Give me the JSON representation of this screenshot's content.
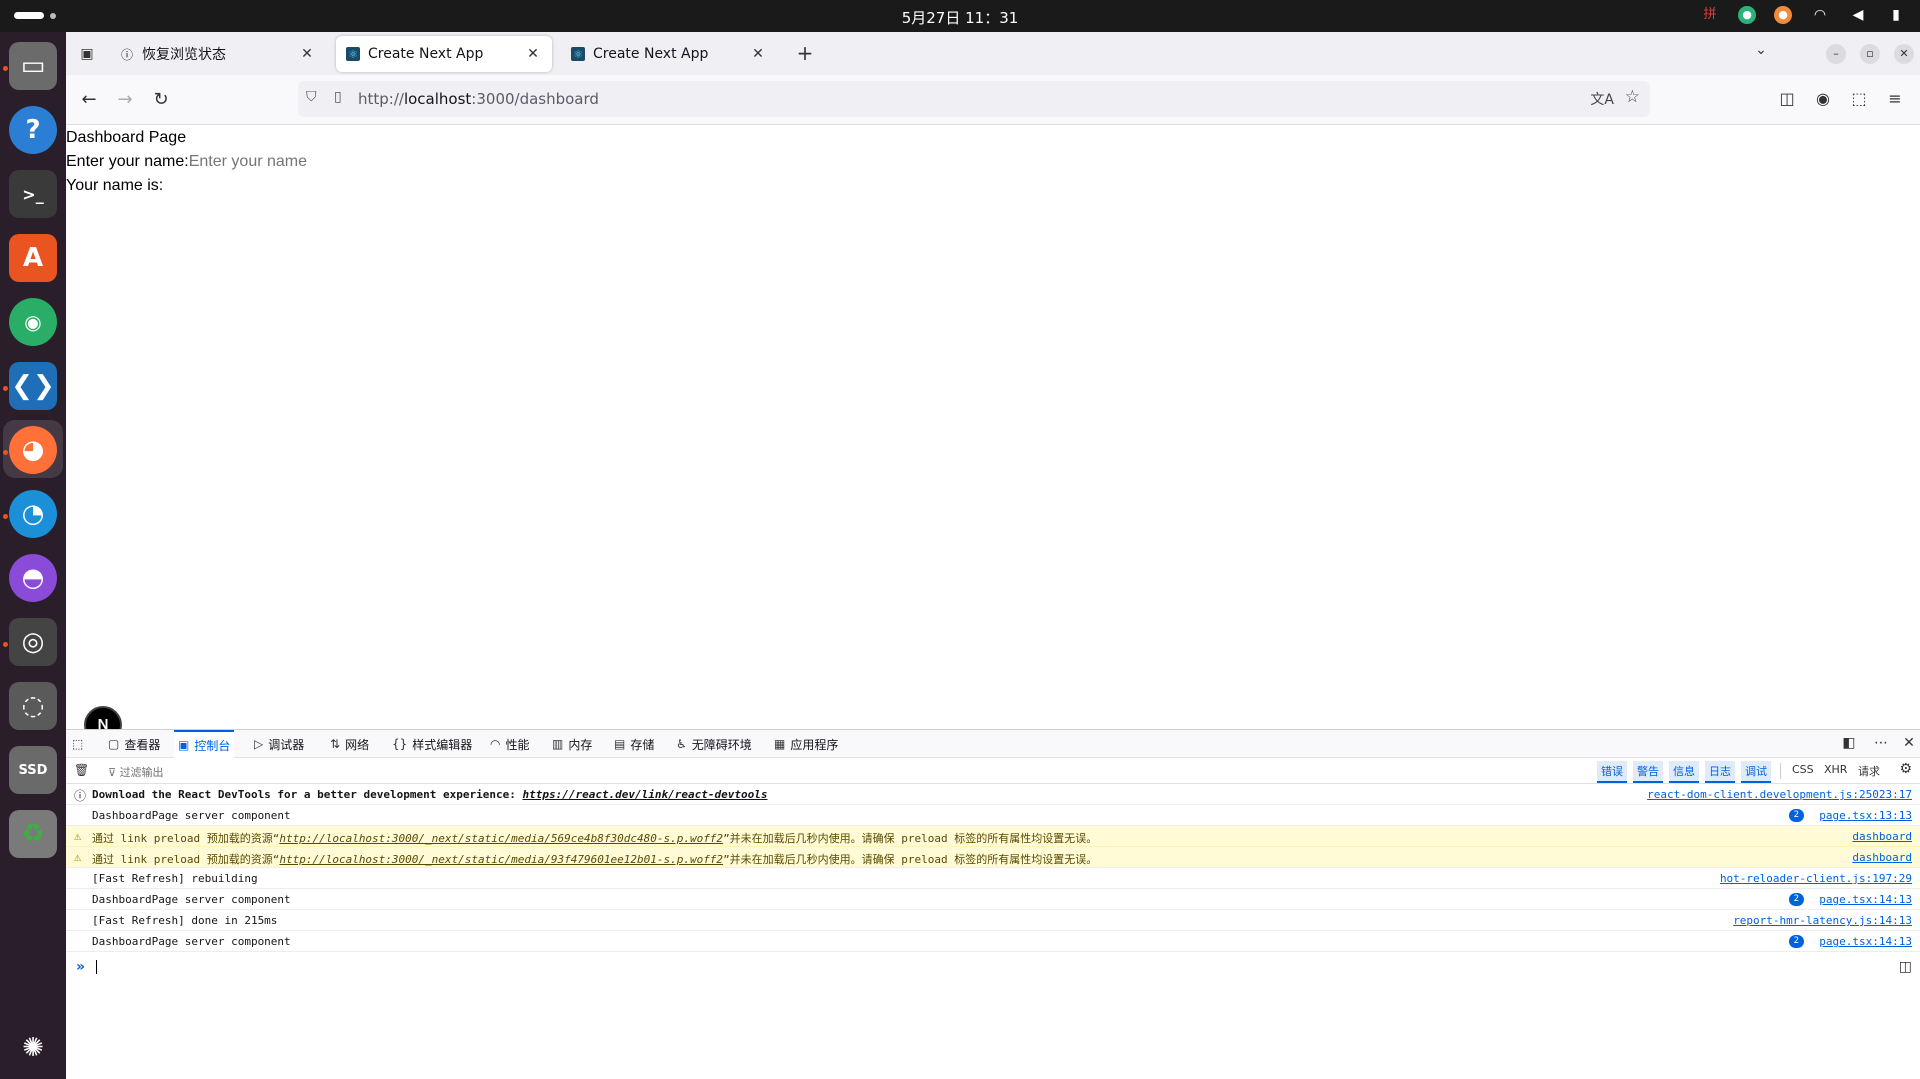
{
  "system": {
    "clock": "5月27日  11：31",
    "ime": "拼"
  },
  "browser": {
    "tabs": [
      {
        "title": "恢复浏览状态",
        "icon": "info-icon"
      },
      {
        "title": "Create Next App",
        "icon": "react-icon",
        "active": true
      },
      {
        "title": "Create Next App",
        "icon": "react-icon"
      }
    ],
    "url": {
      "prefix": "http://",
      "host": "localhost",
      "rest": ":3000/dashboard"
    }
  },
  "page": {
    "heading": "Dashboard Page",
    "name_label": "Enter your name:",
    "name_placeholder": "Enter your name",
    "name_value": "",
    "result_label": "Your name is:",
    "next_badge": "N"
  },
  "devtools": {
    "tabs": [
      "查看器",
      "控制台",
      "调试器",
      "网络",
      "样式编辑器",
      "性能",
      "内存",
      "存储",
      "无障碍环境",
      "应用程序"
    ],
    "active_tab": "控制台",
    "filter_placeholder": "过滤输出",
    "levels": [
      "错误",
      "警告",
      "信息",
      "日志",
      "调试"
    ],
    "request_types": [
      "CSS",
      "XHR",
      "请求"
    ],
    "messages": [
      {
        "type": "info",
        "text_bold": "Download the React DevTools for a better development experience: ",
        "link": "https://react.dev/link/react-devtools",
        "source": "react-dom-client.development.js:25023:17"
      },
      {
        "type": "log",
        "text": "DashboardPage server component",
        "count": "2",
        "source": "page.tsx:13:13"
      },
      {
        "type": "warn",
        "pre": "通过 link preload 预加载的资源“",
        "link": "http://localhost:3000/_next/static/media/569ce4b8f30dc480-s.p.woff2",
        "post": "”并未在加载后几秒内使用。请确保 preload 标签的所有属性均设置无误。",
        "source": "dashboard"
      },
      {
        "type": "warn",
        "pre": "通过 link preload 预加载的资源“",
        "link": "http://localhost:3000/_next/static/media/93f479601ee12b01-s.p.woff2",
        "post": "”并未在加载后几秒内使用。请确保 preload 标签的所有属性均设置无误。",
        "source": "dashboard"
      },
      {
        "type": "log",
        "text": "[Fast Refresh] rebuilding",
        "source": "hot-reloader-client.js:197:29"
      },
      {
        "type": "log",
        "text": "DashboardPage server component",
        "count": "2",
        "source": "page.tsx:14:13"
      },
      {
        "type": "log",
        "text": "[Fast Refresh] done in 215ms",
        "source": "report-hmr-latency.js:14:13"
      },
      {
        "type": "log",
        "text": "DashboardPage server component",
        "count": "2",
        "source": "page.tsx:14:13"
      }
    ]
  },
  "dock": {
    "storage_label": "SSD"
  },
  "colors": {
    "accent": "#0061e0",
    "warn_bg": "#fffbd6",
    "dock_bg": "#2b1e2b"
  }
}
